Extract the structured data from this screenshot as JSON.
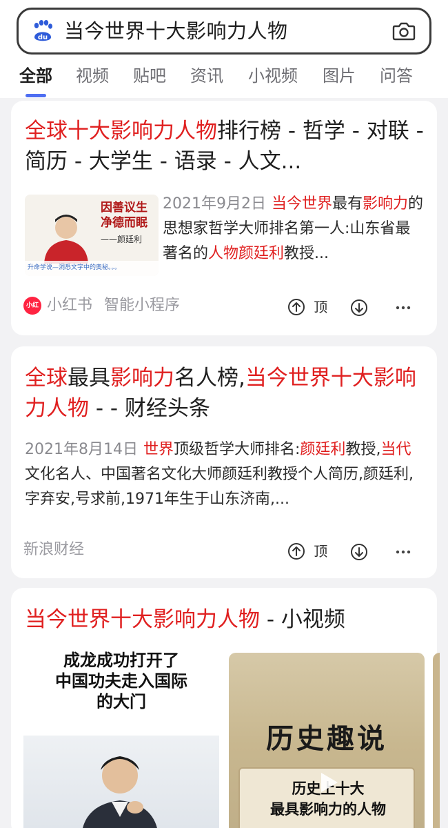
{
  "search": {
    "query": "当今世界十大影响力人物",
    "logo_text": "du"
  },
  "tabs": [
    {
      "label": "全部",
      "active": true
    },
    {
      "label": "视频"
    },
    {
      "label": "贴吧"
    },
    {
      "label": "资讯"
    },
    {
      "label": "小视频"
    },
    {
      "label": "图片"
    },
    {
      "label": "问答"
    }
  ],
  "results": [
    {
      "title_parts": [
        {
          "text": "全球十大影响力人物",
          "hl": true
        },
        {
          "text": "排行榜 - 哲学 - 对联 - 简历 - 大学生 - 语录 - 人文...",
          "hl": false
        }
      ],
      "thumb": {
        "line1": "因善议生",
        "line2": "净德而眠",
        "sign": "——颜廷利",
        "caption": "升命学说—洞悉文字中的奥秘。。。"
      },
      "abstract_parts": [
        {
          "text": "2021年9月2日",
          "date": true
        },
        {
          "text": "当今世界",
          "hl": true
        },
        {
          "text": "最有",
          "hl": false
        },
        {
          "text": "影响力",
          "hl": true
        },
        {
          "text": "的思想家哲学大师排名第一人:山东省最著名的",
          "hl": false
        },
        {
          "text": "人物颜廷利",
          "hl": true
        },
        {
          "text": "教授...",
          "hl": false
        }
      ],
      "source": {
        "icon_text": "小红书",
        "name": "小红书",
        "extra": "智能小程序"
      },
      "up_label": "顶"
    },
    {
      "title_parts": [
        {
          "text": "全球",
          "hl": true
        },
        {
          "text": "最具",
          "hl": false
        },
        {
          "text": "影响力",
          "hl": true
        },
        {
          "text": "名人榜,",
          "hl": false
        },
        {
          "text": "当今世界十大影响力人物",
          "hl": true
        },
        {
          "text": " - - 财经头条",
          "hl": false
        }
      ],
      "abstract_parts": [
        {
          "text": "2021年8月14日",
          "date": true
        },
        {
          "text": "世界",
          "hl": true
        },
        {
          "text": "顶级哲学大师排名:",
          "hl": false
        },
        {
          "text": "颜廷利",
          "hl": true
        },
        {
          "text": "教授,",
          "hl": false
        },
        {
          "text": "当代",
          "hl": true
        },
        {
          "text": "文化名人、中国著名文化大师颜廷利教授个人简历,颜廷利,字弃安,号求前,1971年生于山东济南,...",
          "hl": false
        }
      ],
      "source": {
        "name": "新浪财经"
      },
      "up_label": "顶"
    }
  ],
  "video_section": {
    "title_hl": "当今世界十大影响力人物",
    "title_rest": " - 小视频",
    "video_a": {
      "headline": "成龙成功打开了\n中国功夫走入国际\n的大门"
    },
    "video_b": {
      "title": "历史趣说",
      "subtitle": "历史上十大\n最具影响力的人物"
    }
  },
  "colors": {
    "highlight": "#e02020",
    "tab_underline": "#4e6ef2",
    "baidu_blue": "#2e5bd9",
    "xiaohongshu": "#ff2442"
  }
}
